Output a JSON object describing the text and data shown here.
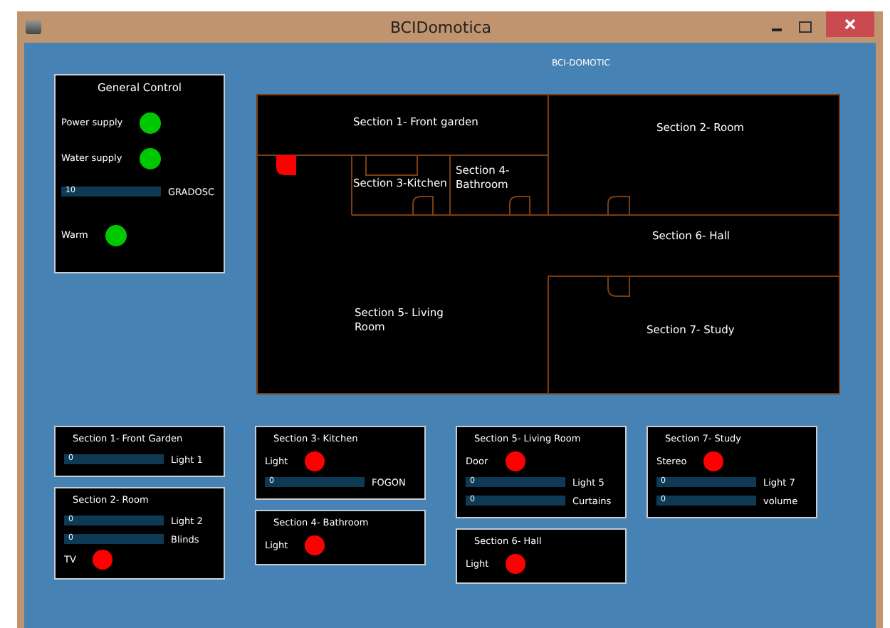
{
  "window": {
    "title": "BCIDomotica"
  },
  "header": "BCI-DOMOTIC",
  "general_control": {
    "title": "General Control",
    "controls": [
      {
        "kind": "indicator",
        "label": "Power supply",
        "on": true
      },
      {
        "kind": "indicator",
        "label": "Water supply",
        "on": true
      },
      {
        "kind": "slider",
        "reading": "10",
        "label": "GRADOSC"
      },
      {
        "kind": "indicator",
        "label": "Warm",
        "on": true
      }
    ]
  },
  "floor_plan": {
    "entrance_door": {
      "on": false
    },
    "rooms": [
      {
        "label": "Section 1- Front garden"
      },
      {
        "label": "Section 2- Room"
      },
      {
        "label": "Section 3-Kitchen"
      },
      {
        "label": "Section 4-"
      },
      {
        "label": "Bathroom"
      },
      {
        "label": "Section 6- Hall"
      },
      {
        "label": "Section 5- Living"
      },
      {
        "label": "Room"
      },
      {
        "label": "Section 7- Study"
      }
    ]
  },
  "section_columns": [
    [
      {
        "title": "Section 1- Front Garden",
        "controls": [
          {
            "kind": "slider",
            "reading": "0",
            "label": "Light 1"
          }
        ]
      },
      {
        "title": "Section 2- Room",
        "controls": [
          {
            "kind": "slider",
            "reading": "0",
            "label": "Light 2"
          },
          {
            "kind": "slider",
            "reading": "0",
            "label": "Blinds"
          },
          {
            "kind": "indicator",
            "label": "TV",
            "on": false
          }
        ]
      }
    ],
    [
      {
        "title": "Section 3- Kitchen",
        "controls": [
          {
            "kind": "indicator",
            "label": "Light",
            "on": false
          },
          {
            "kind": "slider",
            "reading": "0",
            "label": "FOGON"
          }
        ]
      },
      {
        "title": "Section 4- Bathroom",
        "controls": [
          {
            "kind": "indicator",
            "label": "Light",
            "on": false
          }
        ]
      }
    ],
    [
      {
        "title": "Section 5- Living Room",
        "controls": [
          {
            "kind": "indicator",
            "label": "Door",
            "on": false
          },
          {
            "kind": "slider",
            "reading": "0",
            "label": "Light 5"
          },
          {
            "kind": "slider",
            "reading": "0",
            "label": "Curtains"
          }
        ]
      },
      {
        "title": "Section 6- Hall",
        "controls": [
          {
            "kind": "indicator",
            "label": "Light",
            "on": false
          }
        ]
      }
    ],
    [
      {
        "title": "Section 7- Study",
        "controls": [
          {
            "kind": "indicator",
            "label": "Stereo",
            "on": false
          },
          {
            "kind": "slider",
            "reading": "0",
            "label": "Light 7"
          },
          {
            "kind": "slider",
            "reading": "0",
            "label": "volume"
          }
        ]
      }
    ]
  ]
}
